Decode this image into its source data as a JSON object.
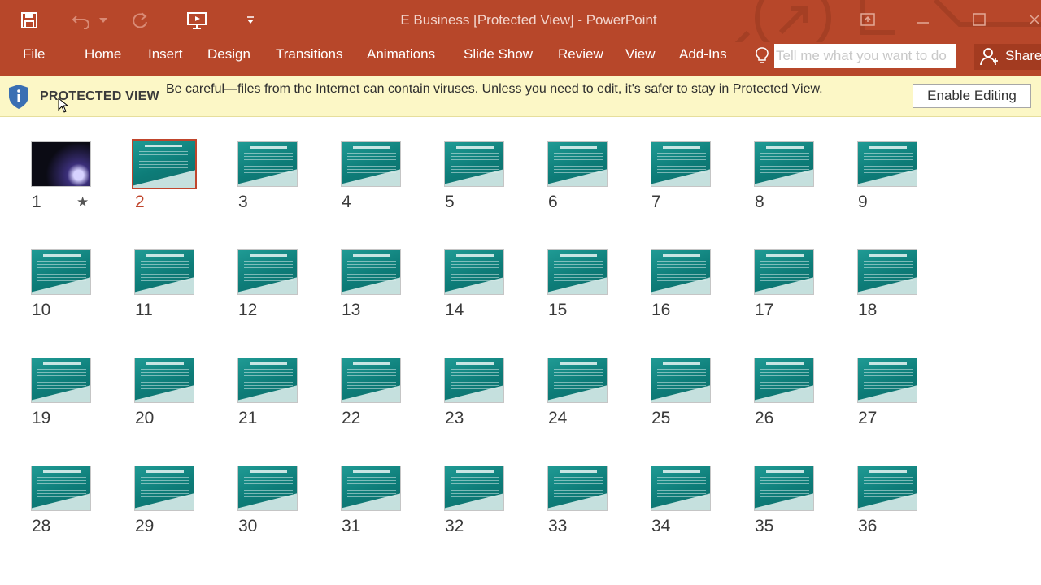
{
  "window": {
    "title": "E Business [Protected View] - PowerPoint"
  },
  "menu": {
    "file": "File",
    "home": "Home",
    "insert": "Insert",
    "design": "Design",
    "transitions": "Transitions",
    "animations": "Animations",
    "slideshow": "Slide Show",
    "review": "Review",
    "view": "View",
    "addins": "Add-Ins",
    "tellme_placeholder": "Tell me what you want to do",
    "share": "Share"
  },
  "protected_view": {
    "label": "PROTECTED VIEW",
    "message": "Be careful—files from the Internet can contain viruses. Unless you need to edit, it's safer to stay in Protected View.",
    "enable_button": "Enable Editing"
  },
  "slides": {
    "selected": 2,
    "animation_marker": "★",
    "numbers": [
      "1",
      "2",
      "3",
      "4",
      "5",
      "6",
      "7",
      "8",
      "9",
      "10",
      "11",
      "12",
      "13",
      "14",
      "15",
      "16",
      "17",
      "18",
      "19",
      "20",
      "21",
      "22",
      "23",
      "24",
      "25",
      "26",
      "27",
      "28",
      "29",
      "30",
      "31",
      "32",
      "33",
      "34",
      "35",
      "36"
    ]
  },
  "colors": {
    "ribbon": "#b7472a",
    "protected_bar": "#fcf7c6",
    "selection": "#c0452c"
  }
}
